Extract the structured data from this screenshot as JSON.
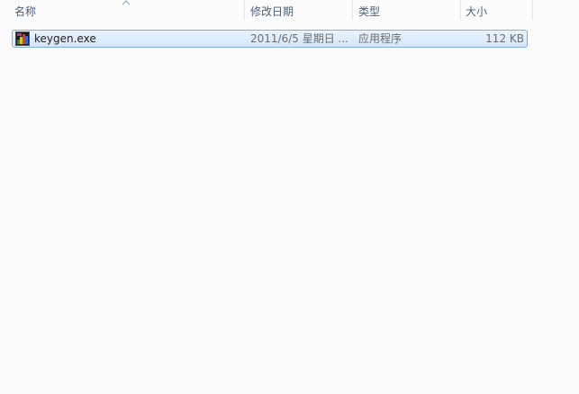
{
  "columns": {
    "name": "名称",
    "modified": "修改日期",
    "type": "类型",
    "size": "大小"
  },
  "files": [
    {
      "name": "keygen.exe",
      "modified": "2011/6/5 星期日 ...",
      "type": "应用程序",
      "size": "112 KB",
      "icon": "keygen-exe-icon"
    }
  ],
  "colors": {
    "selection_border": "#84acdd",
    "selection_fill": "#d4e6fb",
    "header_text": "#4c607a"
  }
}
